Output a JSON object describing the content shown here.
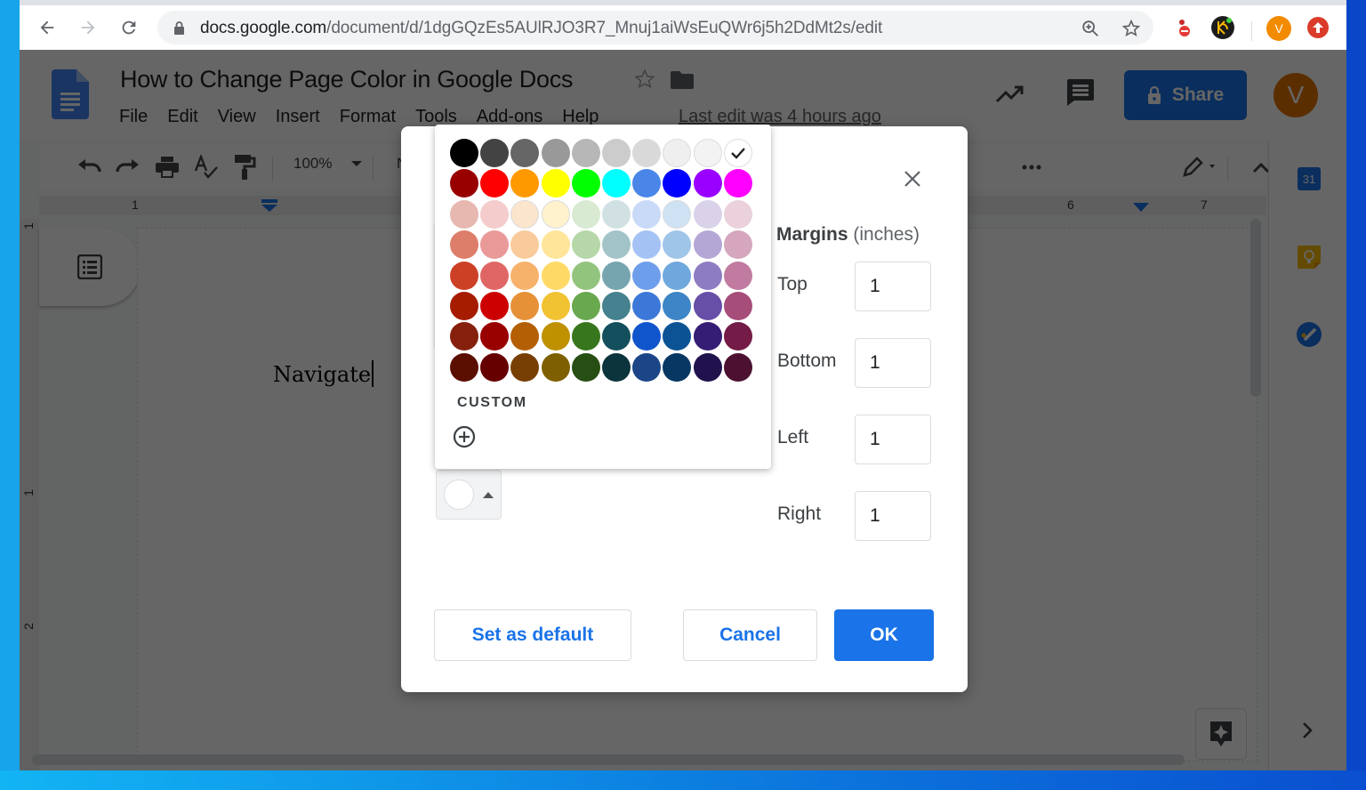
{
  "browser": {
    "url_host": "docs.google.com",
    "url_path": "/document/d/1dgGQzEs5AUlRJO3R7_Mnuj1aiWsEuQWr6j5h2DdMt2s/edit",
    "profile_initial": "V",
    "extensions": [
      "extension-red-icon",
      "keeper-extension-icon",
      "profile-avatar",
      "update-icon"
    ]
  },
  "docs": {
    "title": "How to Change Page Color in Google Docs",
    "menu": [
      "File",
      "Edit",
      "View",
      "Insert",
      "Format",
      "Tools",
      "Add-ons",
      "Help"
    ],
    "last_edit": "Last edit was 4 hours ago",
    "share_label": "Share",
    "avatar_initial": "V",
    "toolbar": {
      "zoom": "100%",
      "style_partial": "No"
    },
    "ruler": {
      "h_numbers": [
        "1",
        "6",
        "7"
      ],
      "v_numbers": [
        "1",
        "1",
        "2"
      ]
    },
    "body_text": "Navigate",
    "side_panel": [
      "calendar-icon",
      "keep-icon",
      "tasks-icon"
    ],
    "calendar_day": "31"
  },
  "dialog": {
    "margins_label": "Margins",
    "margins_unit": "(inches)",
    "margins": [
      {
        "label": "Top",
        "value": "1"
      },
      {
        "label": "Bottom",
        "value": "1"
      },
      {
        "label": "Left",
        "value": "1"
      },
      {
        "label": "Right",
        "value": "1"
      }
    ],
    "buttons": {
      "set_default": "Set as default",
      "cancel": "Cancel",
      "ok": "OK"
    },
    "page_color": "#ffffff"
  },
  "palette": {
    "selected": "#ffffff",
    "custom_label": "CUSTOM",
    "rows": [
      [
        "#000000",
        "#434343",
        "#666666",
        "#999999",
        "#b7b7b7",
        "#cccccc",
        "#d9d9d9",
        "#efefef",
        "#f3f3f3",
        "#ffffff"
      ],
      [
        "#980000",
        "#ff0000",
        "#ff9900",
        "#ffff00",
        "#00ff00",
        "#00ffff",
        "#4a86e8",
        "#0000ff",
        "#9900ff",
        "#ff00ff"
      ],
      [
        "#e6b8af",
        "#f4cccc",
        "#fce5cd",
        "#fff2cc",
        "#d9ead3",
        "#d0e0e3",
        "#c9daf8",
        "#cfe2f3",
        "#d9d2e9",
        "#ead1dc"
      ],
      [
        "#dd7e6b",
        "#ea9999",
        "#f9cb9c",
        "#ffe599",
        "#b6d7a8",
        "#a2c4c9",
        "#a4c2f4",
        "#9fc5e8",
        "#b4a7d6",
        "#d5a6bd"
      ],
      [
        "#cc4125",
        "#e06666",
        "#f6b26b",
        "#ffd966",
        "#93c47d",
        "#76a5af",
        "#6d9eeb",
        "#6fa8dc",
        "#8e7cc3",
        "#c27ba0"
      ],
      [
        "#a61c00",
        "#cc0000",
        "#e69138",
        "#f1c232",
        "#6aa84f",
        "#45818e",
        "#3c78d8",
        "#3d85c6",
        "#674ea7",
        "#a64d79"
      ],
      [
        "#85200c",
        "#990000",
        "#b45f06",
        "#bf9000",
        "#38761d",
        "#134f5c",
        "#1155cc",
        "#0b5394",
        "#351c75",
        "#741b47"
      ],
      [
        "#5b0f00",
        "#660000",
        "#783f04",
        "#7f6000",
        "#274e13",
        "#0c343d",
        "#1c4587",
        "#073763",
        "#20124d",
        "#4c1130"
      ]
    ]
  }
}
